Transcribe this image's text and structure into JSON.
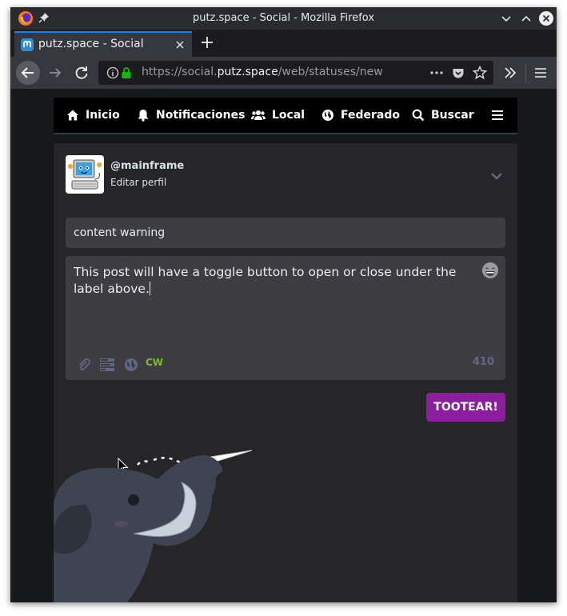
{
  "window": {
    "title": "putz.space - Social - Mozilla Firefox"
  },
  "tabs": [
    {
      "label": "putz.space - Social",
      "active": true
    }
  ],
  "urlbar": {
    "url_prefix": "https://social.",
    "url_domain": "putz.space",
    "url_path": "/web/statuses/new"
  },
  "nav": {
    "items": [
      {
        "label": "Inicio",
        "icon": "home-icon"
      },
      {
        "label": "Notificaciones",
        "icon": "bell-icon"
      },
      {
        "label": "Local",
        "icon": "users-icon"
      },
      {
        "label": "Federado",
        "icon": "globe-icon"
      },
      {
        "label": "Buscar",
        "icon": "search-icon"
      }
    ],
    "menu_icon": "hamburger-icon"
  },
  "compose": {
    "account": "@mainframe",
    "edit_profile": "Editar perfil",
    "cw_value": "content warning",
    "text_value": "This post will have a toggle button to open or close under the label above.",
    "cw_toggle": "CW",
    "char_counter": "410",
    "submit_label": "TOOTEAR!"
  },
  "colors": {
    "accent": "#8c1d9e",
    "cw_active": "#79bd2a",
    "nav_bg": "#000000",
    "compose_bg": "#262629"
  }
}
